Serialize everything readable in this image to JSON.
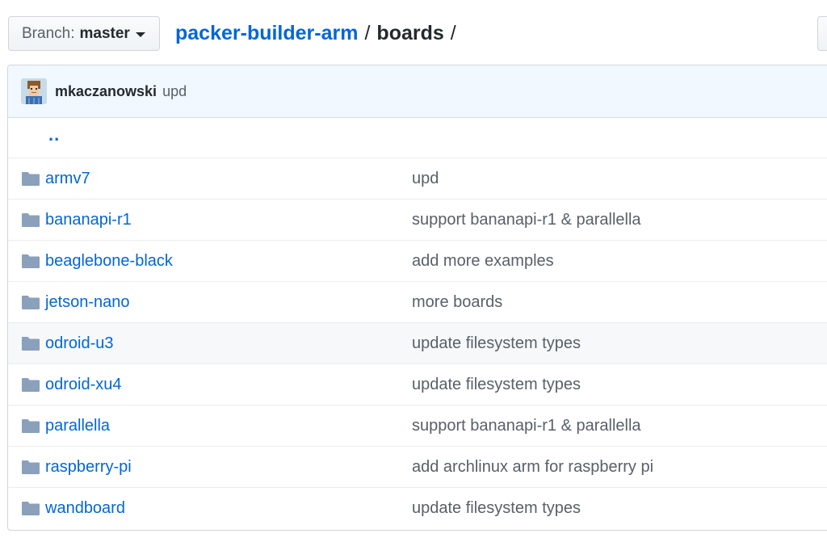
{
  "branch": {
    "label": "Branch:",
    "value": "master"
  },
  "breadcrumb": {
    "repo": "packer-builder-arm",
    "sep1": "/",
    "dir": "boards",
    "sep2": "/"
  },
  "commit": {
    "author": "mkaczanowski",
    "message": "upd"
  },
  "parent_link": "..",
  "files": [
    {
      "name": "armv7",
      "message": "upd"
    },
    {
      "name": "bananapi-r1",
      "message": "support bananapi-r1 & parallella"
    },
    {
      "name": "beaglebone-black",
      "message": "add more examples"
    },
    {
      "name": "jetson-nano",
      "message": "more boards"
    },
    {
      "name": "odroid-u3",
      "message": "update filesystem types"
    },
    {
      "name": "odroid-xu4",
      "message": "update filesystem types"
    },
    {
      "name": "parallella",
      "message": "support bananapi-r1 & parallella"
    },
    {
      "name": "raspberry-pi",
      "message": "add archlinux arm for raspberry pi"
    },
    {
      "name": "wandboard",
      "message": "update filesystem types"
    }
  ],
  "colors": {
    "link": "#0366d6",
    "folder": "#79b8ff",
    "commit_bg": "#f1f8ff",
    "hover_row": "#f6f8fa"
  },
  "icons": {
    "folder": "folder-icon",
    "caret": "caret-down-icon"
  }
}
